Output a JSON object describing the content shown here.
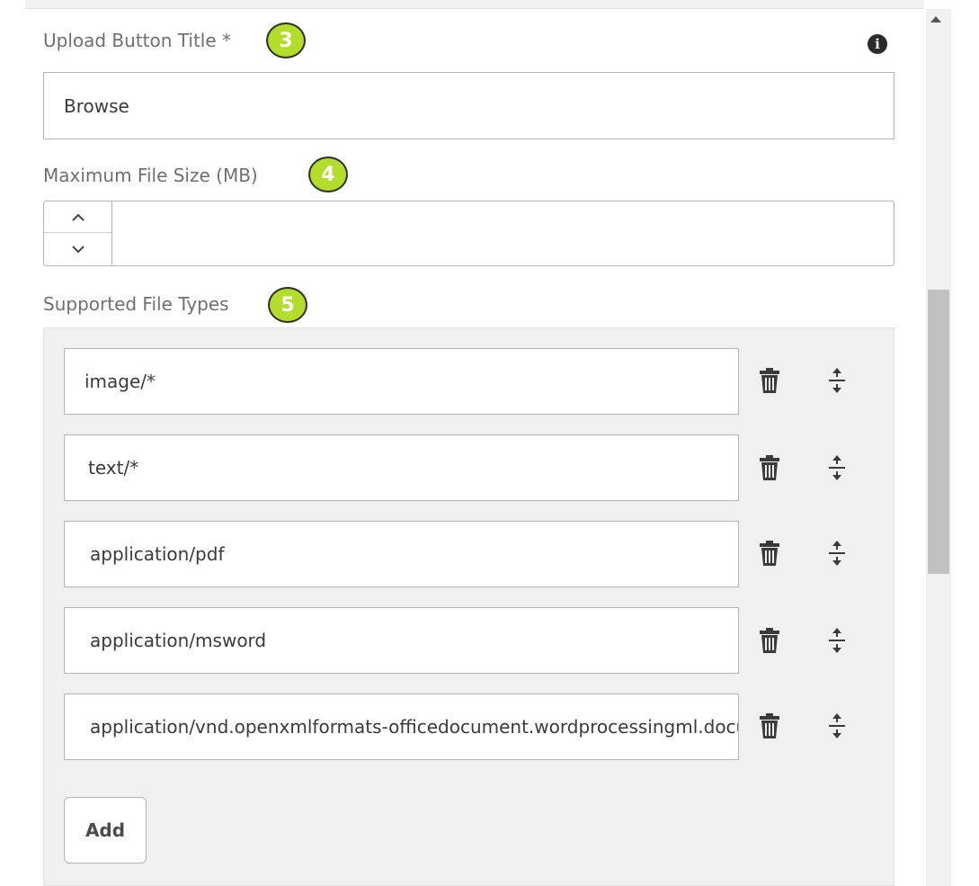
{
  "upload_title": {
    "label": "Upload Button Title *",
    "value": "Browse",
    "badge": "3",
    "info_icon": "info-icon"
  },
  "max_size": {
    "label": "Maximum File Size (MB)",
    "value": "",
    "badge": "4",
    "up_icon": "chevron-up-icon",
    "down_icon": "chevron-down-icon"
  },
  "file_types": {
    "label": "Supported File Types",
    "badge": "5",
    "items": [
      {
        "value": "image/*"
      },
      {
        "value": "text/*"
      },
      {
        "value": "application/pdf"
      },
      {
        "value": "application/msword"
      },
      {
        "value": "application/vnd.openxmlformats-officedocument.wordprocessingml.document"
      }
    ],
    "delete_icon": "trash-icon",
    "reorder_icon": "move-vertical-icon",
    "add_label": "Add"
  },
  "colors": {
    "badge": "#b2dd2b",
    "scroll_thumb": "#c1c1c1"
  }
}
